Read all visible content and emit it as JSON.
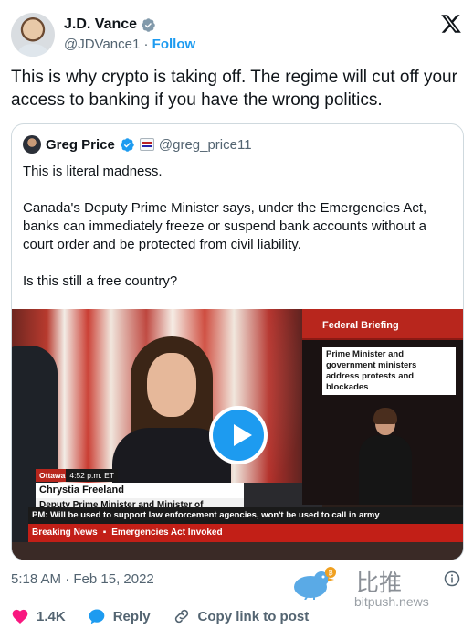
{
  "author": {
    "name": "J.D. Vance",
    "handle": "@JDVance1",
    "separator": " · ",
    "follow_label": "Follow"
  },
  "tweet_text": "This is why crypto is taking off. The regime will cut off your access to banking if you have the wrong politics.",
  "quoted": {
    "name": "Greg Price",
    "handle": "@greg_price11",
    "body": "This is literal madness.\n\nCanada's Deputy Prime Minister says, under the Emergencies Act, banks can immediately freeze or suspend bank accounts without a court order and be protected from civil liability.\n\nIs this still a free country?",
    "video": {
      "side_title": "Federal Briefing",
      "side_subtitle": "Prime Minister and government ministers address protests and blockades",
      "location": "Ottawa",
      "time": "4:52 p.m. ET",
      "speaker_name": "Chrystia Freeland",
      "speaker_title": "Deputy Prime Minister and Minister of Finance",
      "ticker": "PM: Will be used to support law enforcement agencies, won't be used to call in army",
      "breaking_label": "Breaking News",
      "breaking_headline": "Emergencies Act Invoked",
      "bullet": "▪"
    }
  },
  "timestamp": "5:18 AM · Feb 15, 2022",
  "watermark": {
    "chinese": "比推",
    "url": "bitpush.news"
  },
  "actions": {
    "likes": "1.4K",
    "reply_label": "Reply",
    "copy_link_label": "Copy link to post"
  },
  "colors": {
    "accent": "#1d9bf0",
    "like": "#f91880",
    "text": "#0f1419",
    "muted": "#536471",
    "news_red": "#c21f17"
  }
}
